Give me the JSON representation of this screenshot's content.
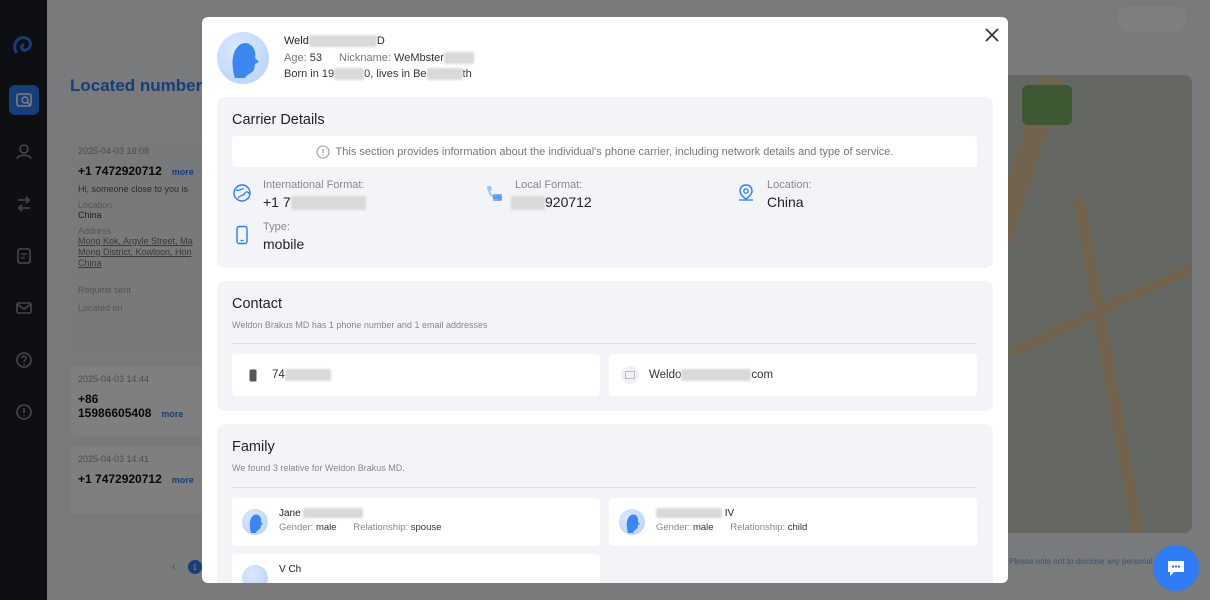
{
  "background": {
    "page_title": "Located number",
    "cards": [
      {
        "date": "2025-04-03 18:08",
        "number": "+1 7472920712",
        "more": "more",
        "message": "Hi, someone close to you is",
        "country_label": "Location",
        "country": "China",
        "address_label": "Address",
        "address": "Mong Kok, Argyle Street, Ma Mong District, Kowloon, Hon China",
        "req_label": "Request sent",
        "loc_label": "Located on"
      },
      {
        "date": "2025-04-03 14:44",
        "number": "+86 15986605408",
        "more": "more"
      },
      {
        "date": "2025-04-03 14:41",
        "number": "+1 7472920712",
        "more": "more"
      }
    ],
    "pager_current": "1",
    "disclaimer": "Please note not to disclose any personal data"
  },
  "profile": {
    "name_visible_start": "Weld",
    "name_visible_end": "D",
    "age_label": "Age:",
    "age": "53",
    "nickname_label": "Nickname:",
    "nickname_visible": "WeMbster",
    "born_prefix": "Born in 19",
    "born_mid": "0, lives in Be",
    "born_end": "th"
  },
  "carrier": {
    "title": "Carrier Details",
    "info": "This section provides information about the individual's phone carrier, including network details and type of service.",
    "intl_label": "International Format:",
    "intl_value": "+1 7",
    "local_label": "Local Format:",
    "local_value": "920712",
    "location_label": "Location:",
    "location_value": "China",
    "type_label": "Type:",
    "type_value": "mobile"
  },
  "contact": {
    "title": "Contact",
    "subtitle": "Weldon Brakus MD has 1 phone number and 1 email addresses",
    "phone_visible": "74",
    "email_visible_start": "Weldo",
    "email_visible_end": "com"
  },
  "family": {
    "title": "Family",
    "subtitle": "We found 3 relative for Weldon Brakus MD.",
    "members": [
      {
        "name_visible": "Jane",
        "gender_label": "Gender:",
        "gender": "male",
        "rel_label": "Relationship:",
        "relationship": "spouse"
      },
      {
        "name_visible": "IV",
        "gender_label": "Gender:",
        "gender": "male",
        "rel_label": "Relationship:",
        "relationship": "child"
      },
      {
        "name_visible": "V Ch"
      }
    ]
  },
  "colors": {
    "accent": "#2f7cf6",
    "sidebar": "#1c1f27"
  }
}
